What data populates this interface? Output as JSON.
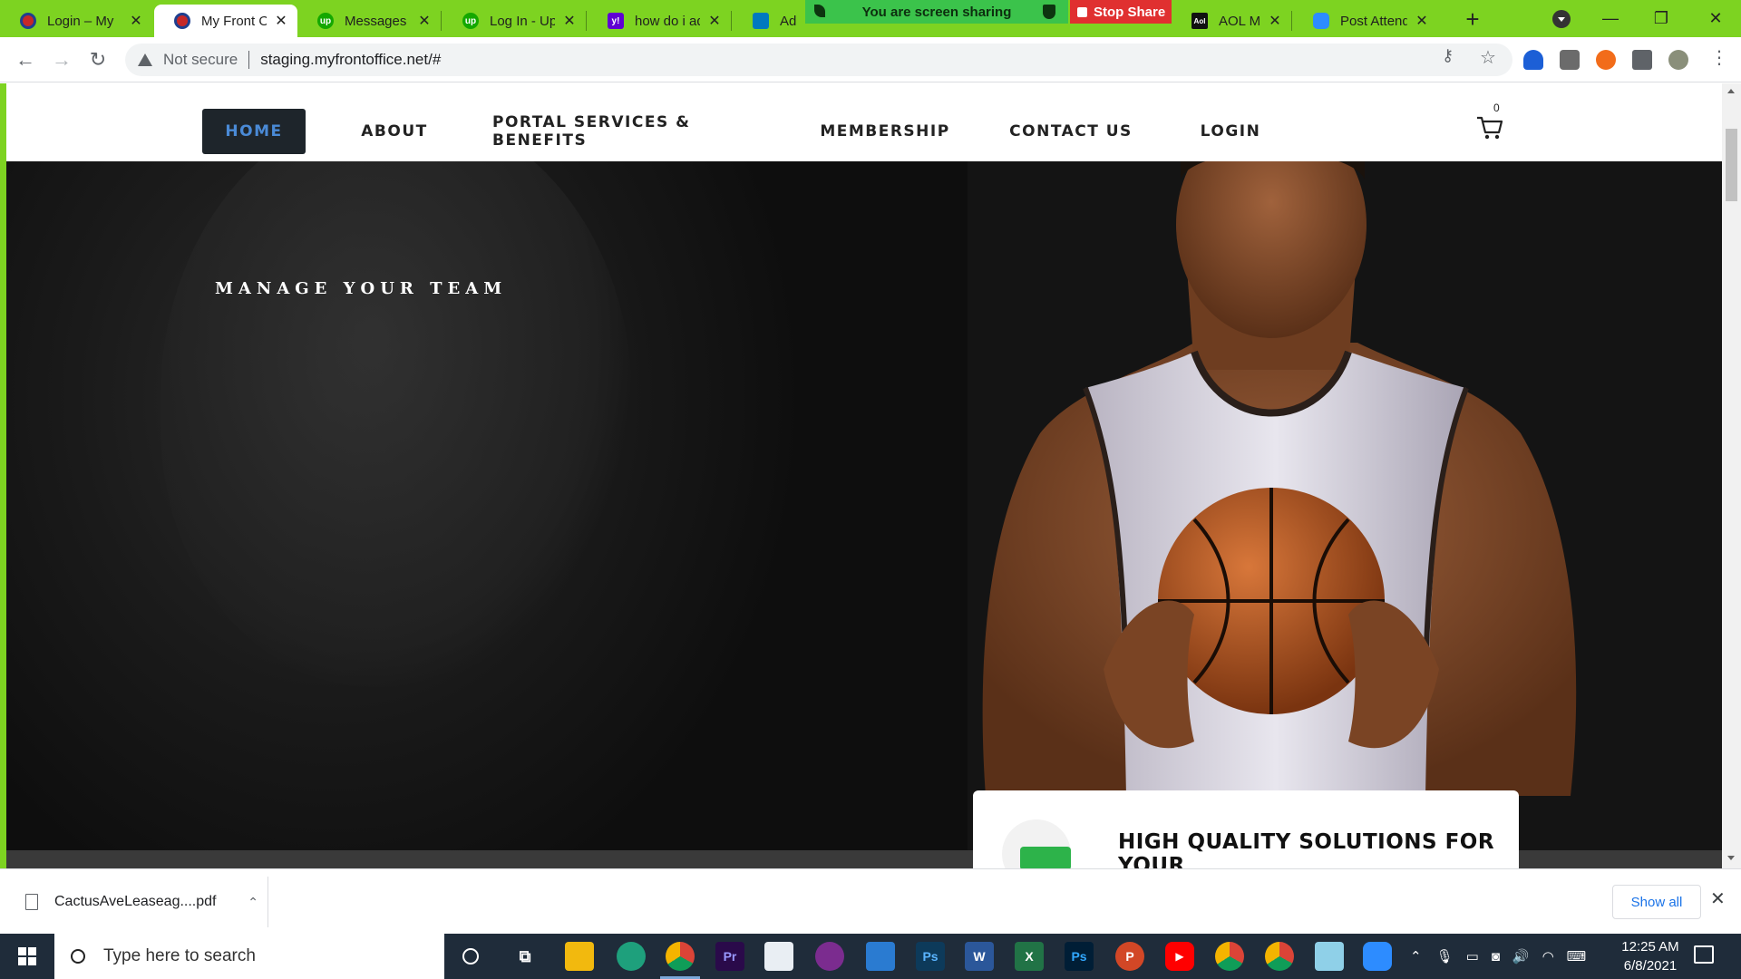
{
  "browser": {
    "tabs": [
      {
        "title": "Login – My",
        "favicon": "front-office-icon",
        "color": "#c62828"
      },
      {
        "title": "My Front O",
        "favicon": "front-office-icon",
        "color": "#c62828",
        "active": true
      },
      {
        "title": "Messages",
        "favicon": "upwork-icon",
        "color": "#14a800"
      },
      {
        "title": "Log In - Up",
        "favicon": "upwork-icon",
        "color": "#14a800"
      },
      {
        "title": "how do i ad",
        "favicon": "yahoo-icon",
        "color": "#6001d2"
      },
      {
        "title": "Adding",
        "favicon": "trello-icon",
        "color": "#0079bf"
      },
      {
        "title": "AOL Mail",
        "favicon": "aol-icon",
        "color": "#111111"
      },
      {
        "title": "Post Attend",
        "favicon": "zoom-icon",
        "color": "#2d8cff"
      }
    ],
    "share_banner": "You are screen sharing",
    "stop_share": "Stop Share",
    "new_tab": "+",
    "address": {
      "security": "Not secure",
      "url": "staging.myfrontoffice.net/#"
    }
  },
  "site": {
    "nav": [
      "HOME",
      "ABOUT",
      "PORTAL SERVICES & BENEFITS",
      "MEMBERSHIP",
      "CONTACT US",
      "LOGIN"
    ],
    "cart_count": "0",
    "hero_title": "MANAGE YOUR TEAM",
    "card_title": "HIGH QUALITY SOLUTIONS FOR YOUR"
  },
  "downloads": {
    "file": "CactusAveLeaseag....pdf",
    "show_all": "Show all"
  },
  "taskbar": {
    "search_placeholder": "Type here to search",
    "time": "12:25 AM",
    "date": "6/8/2021",
    "apps": [
      {
        "name": "cortana-icon"
      },
      {
        "name": "task-view-icon"
      },
      {
        "name": "file-explorer-icon"
      },
      {
        "name": "edge-icon"
      },
      {
        "name": "chrome-icon"
      },
      {
        "name": "premiere-icon",
        "label": "Pr"
      },
      {
        "name": "store-icon"
      },
      {
        "name": "affinity-icon"
      },
      {
        "name": "mail-icon"
      },
      {
        "name": "photoshop-express-icon",
        "label": "Ps"
      },
      {
        "name": "word-icon",
        "label": "W"
      },
      {
        "name": "excel-icon",
        "label": "X"
      },
      {
        "name": "photoshop-icon",
        "label": "Ps"
      },
      {
        "name": "powerpoint-icon",
        "label": "P"
      },
      {
        "name": "youtube-icon"
      },
      {
        "name": "chrome-profile-icon"
      },
      {
        "name": "chrome-profile-2-icon"
      },
      {
        "name": "notepad-icon"
      },
      {
        "name": "zoom-icon"
      }
    ]
  },
  "colors": {
    "accent_green": "#7dd321",
    "nav_active_bg": "#1e252b",
    "nav_active_text": "#4a8ad6",
    "taskbar": "#1f2c3a"
  }
}
